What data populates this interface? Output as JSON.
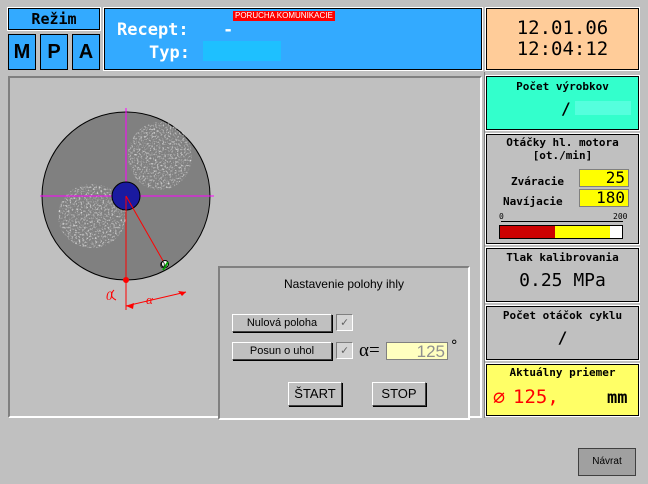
{
  "mode": {
    "title": "Režim",
    "buttons": [
      "M",
      "P",
      "A"
    ]
  },
  "header": {
    "comm_error": "PORUCHA KOMUNIKACIE",
    "recipe_label": "Recept:",
    "recipe_value": "-",
    "type_label": "Typ:",
    "type_value": ""
  },
  "datetime": {
    "date": "12.01.06",
    "time": "12:04:12"
  },
  "product_count": {
    "title": "Počet výrobkov",
    "value": "/"
  },
  "motor": {
    "title_line1": "Otáčky hl. motora",
    "title_line2": "[ot./min]",
    "weld_label": "Zváracie",
    "weld_value": "25",
    "wind_label": "Navíjacie",
    "wind_value": "180",
    "scale_min": "0",
    "scale_max": "200",
    "bar_fill_fraction": 0.9,
    "bar_split_fraction": 0.45,
    "colors": {
      "low": "#cc0000",
      "high": "#ffff00"
    }
  },
  "pressure": {
    "title": "Tlak kalibrovania",
    "value": "0.25 MPa"
  },
  "cycle": {
    "title": "Počet otáčok cyklu",
    "value": "/"
  },
  "diameter": {
    "title": "Aktuálny priemer",
    "symbol": "∅",
    "value": "125,",
    "unit": "mm"
  },
  "needle_dialog": {
    "title": "Nastavenie polohy ihly",
    "zero_button": "Nulová poloha",
    "shift_button": "Posun o uhol",
    "alpha_label": "α=",
    "angle_value": "125",
    "degree": "°",
    "start_button": "ŠTART",
    "stop_button": "STOP"
  },
  "diagram": {
    "zero_label": "0",
    "alpha_label": "α",
    "needle_label": "0"
  },
  "back_button": "Návrat",
  "colors": {
    "blue": "#33aaff",
    "green": "#33ffcc",
    "yellow": "#ffff66",
    "peach": "#ffcc99"
  }
}
